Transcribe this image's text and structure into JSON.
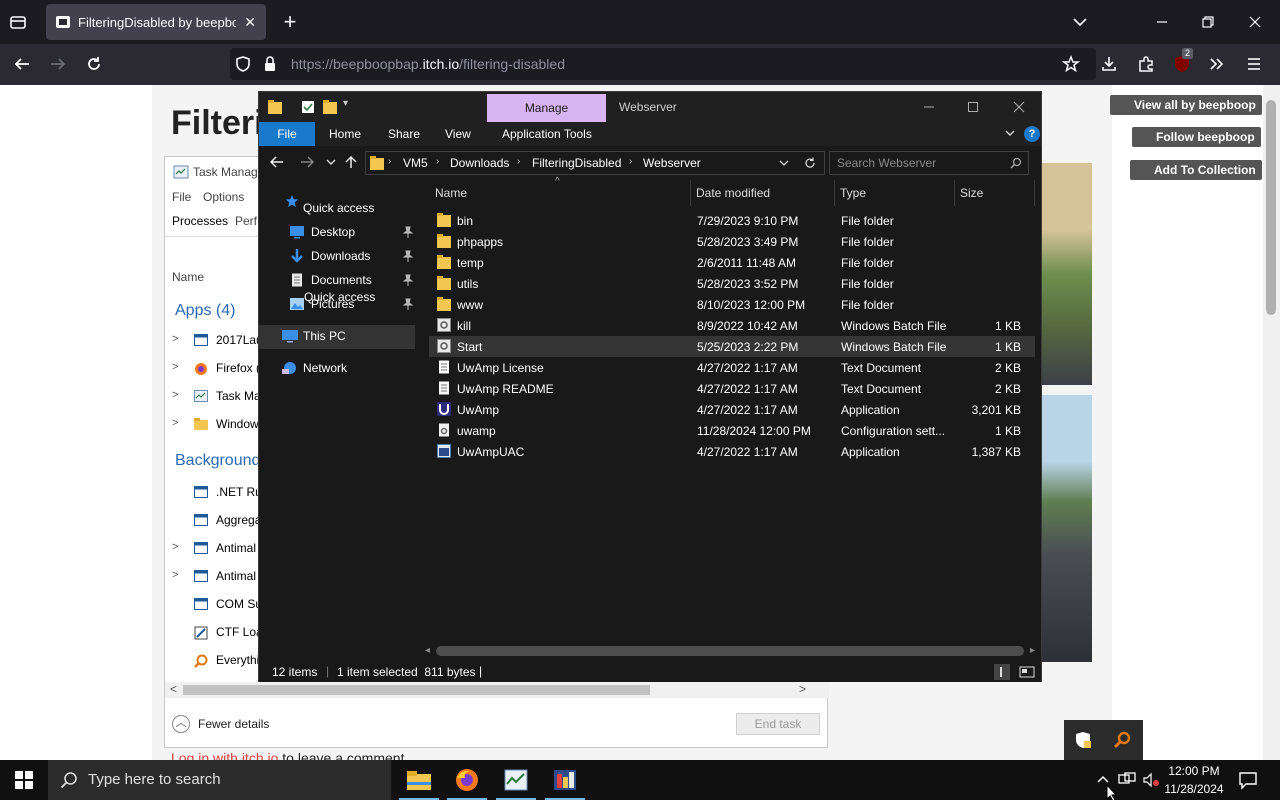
{
  "browser": {
    "tab_title": "FilteringDisabled by beepboop",
    "url_prefix": "https://beepboopbap.",
    "url_domain": "itch.io",
    "url_path": "/filtering-disabled",
    "extension_badge": "2"
  },
  "itch_page": {
    "title_partial": "Filteri",
    "buttons": [
      "View all by beepboop",
      "Follow beepboop",
      "Add To Collection"
    ],
    "login_link": "Log in with itch.io",
    "login_rest": " to leave a comment."
  },
  "task_manager": {
    "title": "Task Manag",
    "menu": [
      "File",
      "Options"
    ],
    "tabs": [
      "Processes",
      "Perf"
    ],
    "column_name": "Name",
    "apps_header": "Apps (4)",
    "apps": [
      "2017Lau",
      "Firefox (",
      "Task Ma",
      "Window"
    ],
    "background_header": "Background",
    "background": [
      ".NET Ru",
      "Aggrega",
      "Antimal",
      "Antimal",
      "COM Su",
      "CTF Loa",
      "Everythi"
    ],
    "fewer_details": "Fewer details",
    "end_task": "End task"
  },
  "explorer": {
    "manage_tab": "Manage",
    "window_title": "Webserver",
    "ribbon_tabs": [
      "File",
      "Home",
      "Share",
      "View",
      "Application Tools"
    ],
    "breadcrumb": [
      "VM5",
      "Downloads",
      "FilteringDisabled",
      "Webserver"
    ],
    "search_placeholder": "Search Webserver",
    "nav": {
      "quick_access": "Quick access",
      "desktop": "Desktop",
      "downloads": "Downloads",
      "documents": "Documents",
      "pictures": "Pictures",
      "this_pc": "This PC",
      "network": "Network"
    },
    "columns": {
      "name": "Name",
      "date": "Date modified",
      "type": "Type",
      "size": "Size"
    },
    "files": [
      {
        "name": "bin",
        "date": "7/29/2023 9:10 PM",
        "type": "File folder",
        "size": "",
        "icon": "folder"
      },
      {
        "name": "phpapps",
        "date": "5/28/2023 3:49 PM",
        "type": "File folder",
        "size": "",
        "icon": "folder"
      },
      {
        "name": "temp",
        "date": "2/6/2011 11:48 AM",
        "type": "File folder",
        "size": "",
        "icon": "folder"
      },
      {
        "name": "utils",
        "date": "5/28/2023 3:52 PM",
        "type": "File folder",
        "size": "",
        "icon": "folder"
      },
      {
        "name": "www",
        "date": "8/10/2023 12:00 PM",
        "type": "File folder",
        "size": "",
        "icon": "folder"
      },
      {
        "name": "kill",
        "date": "8/9/2022 10:42 AM",
        "type": "Windows Batch File",
        "size": "1 KB",
        "icon": "batch"
      },
      {
        "name": "Start",
        "date": "5/25/2023 2:22 PM",
        "type": "Windows Batch File",
        "size": "1 KB",
        "icon": "batch"
      },
      {
        "name": "UwAmp License",
        "date": "4/27/2022 1:17 AM",
        "type": "Text Document",
        "size": "2 KB",
        "icon": "text"
      },
      {
        "name": "UwAmp README",
        "date": "4/27/2022 1:17 AM",
        "type": "Text Document",
        "size": "2 KB",
        "icon": "text"
      },
      {
        "name": "UwAmp",
        "date": "4/27/2022 1:17 AM",
        "type": "Application",
        "size": "3,201 KB",
        "icon": "uwamp-app"
      },
      {
        "name": "uwamp",
        "date": "11/28/2024 12:00 PM",
        "type": "Configuration sett...",
        "size": "1 KB",
        "icon": "config"
      },
      {
        "name": "UwAmpUAC",
        "date": "4/27/2022 1:17 AM",
        "type": "Application",
        "size": "1,387 KB",
        "icon": "app"
      }
    ],
    "selected_index": 6,
    "status_items": "12 items",
    "status_selected": "1 item selected  811 bytes"
  },
  "taskbar": {
    "search_placeholder": "Type here to search",
    "time": "12:00 PM",
    "date": "11/28/2024"
  }
}
